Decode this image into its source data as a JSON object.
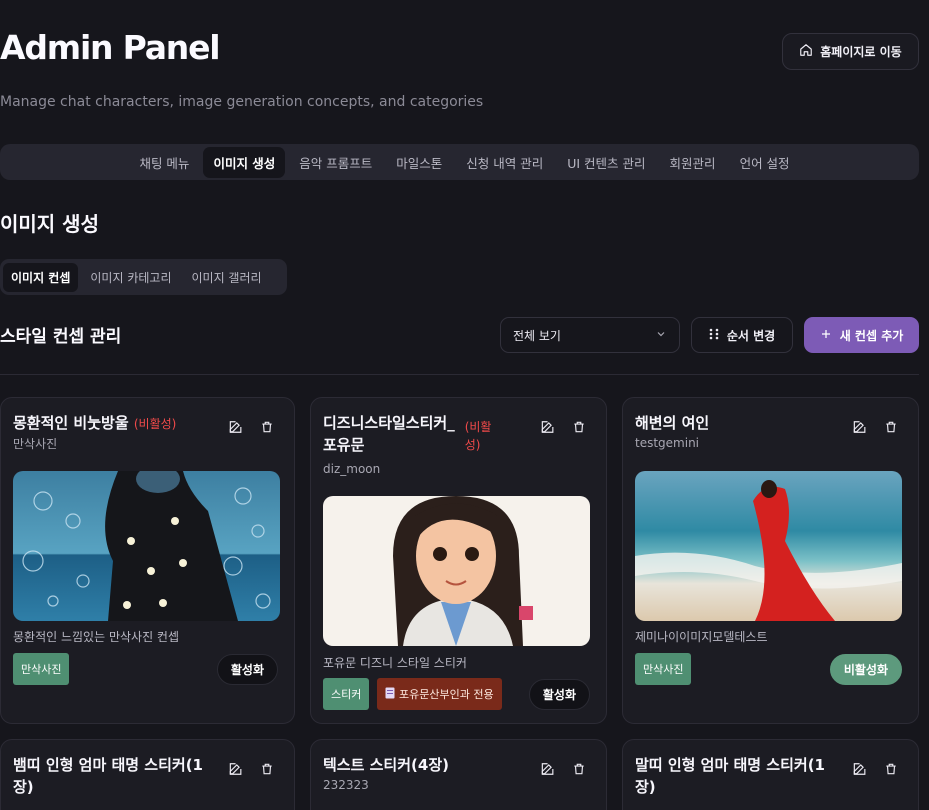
{
  "header": {
    "title": "Admin Panel",
    "subtitle": "Manage chat characters, image generation concepts, and categories",
    "home_button": "홈페이지로 이동"
  },
  "nav": {
    "items": [
      "채팅 메뉴",
      "이미지 생성",
      "음악 프롬프트",
      "마일스톤",
      "신청 내역 관리",
      "UI 컨텐츠 관리",
      "회원관리",
      "언어 설정"
    ],
    "active": "이미지 생성"
  },
  "section": {
    "title": "이미지 생성",
    "subtabs": [
      "이미지 컨셉",
      "이미지 카테고리",
      "이미지 갤러리"
    ],
    "active_subtab": "이미지 컨셉"
  },
  "toolbar": {
    "title": "스타일 컨셉 관리",
    "filter_value": "전체 보기",
    "reorder_label": "순서 변경",
    "add_label": "새 컨셉 추가"
  },
  "cards": [
    {
      "name": "몽환적인 비눗방울",
      "status_tag": "(비활성)",
      "subtitle": "만삭사진",
      "description": "몽환적인 느낌있는 만삭사진 컨셉",
      "tag": "만삭사진",
      "toggle_label": "활성화"
    },
    {
      "name_line1": "디즈니스타일스티커_",
      "name_line2": "포유문",
      "status_line1": "(비활",
      "status_line2": "성)",
      "subtitle": "diz_moon",
      "description": "포유문 디즈니 스타일 스티커",
      "tag": "스티커",
      "tag2": "포유문산부인과 전용",
      "toggle_label": "활성화"
    },
    {
      "name": "해변의 여인",
      "subtitle": "testgemini",
      "description": "제미나이이미지모델테스트",
      "tag": "만삭사진",
      "toggle_label": "비활성화"
    },
    {
      "name_line1": "뱀띠 인형 엄마 태명 스티커(1",
      "name_line2": "장)"
    },
    {
      "name": "텍스트 스티커(4장)",
      "subtitle": "232323"
    },
    {
      "name_line1": "말띠 인형 엄마 태명 스티커(1",
      "name_line2": "장)"
    }
  ],
  "colors": {
    "background": "#16161c",
    "card": "#1c1c23",
    "accent": "#7d5bb6",
    "inactive_red": "#f04a4a",
    "tag_green": "#4f8f72",
    "tag_brown": "#7a2a1a",
    "active_green": "#5d9a7d"
  },
  "icons": [
    "home-icon",
    "chevron-down-icon",
    "drag-handle-icon",
    "plus-icon",
    "edit-icon",
    "trash-icon",
    "file-icon"
  ]
}
